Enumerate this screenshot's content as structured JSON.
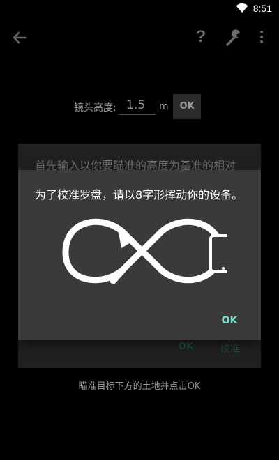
{
  "status_bar": {
    "time": "8:51",
    "wifi_icon": "wifi-icon"
  },
  "toolbar": {
    "back_icon": "arrow-left-icon",
    "help_label": "?",
    "wrench_icon": "wrench-icon",
    "overflow_icon": "more-vertical-icon"
  },
  "height_row": {
    "label": "镜头高度:",
    "value": "1.5",
    "unit": "m",
    "ok_label": "OK"
  },
  "background_dialog": {
    "text": "首先输入以你要瞄准的高度为基准的相对",
    "ok_label": "OK",
    "calibrate_label": "校准"
  },
  "bottom_hint": "瞄准目标下方的土地并点击OK",
  "calibration_dialog": {
    "message": "为了校准罗盘，请以8字形挥动你的设备。",
    "ok_label": "OK",
    "graphic_icon": "figure-eight-phone-icon"
  },
  "colors": {
    "accent": "#7ee0cf",
    "dialog_bg": "#3a3a3a",
    "page_bg": "#000000"
  }
}
